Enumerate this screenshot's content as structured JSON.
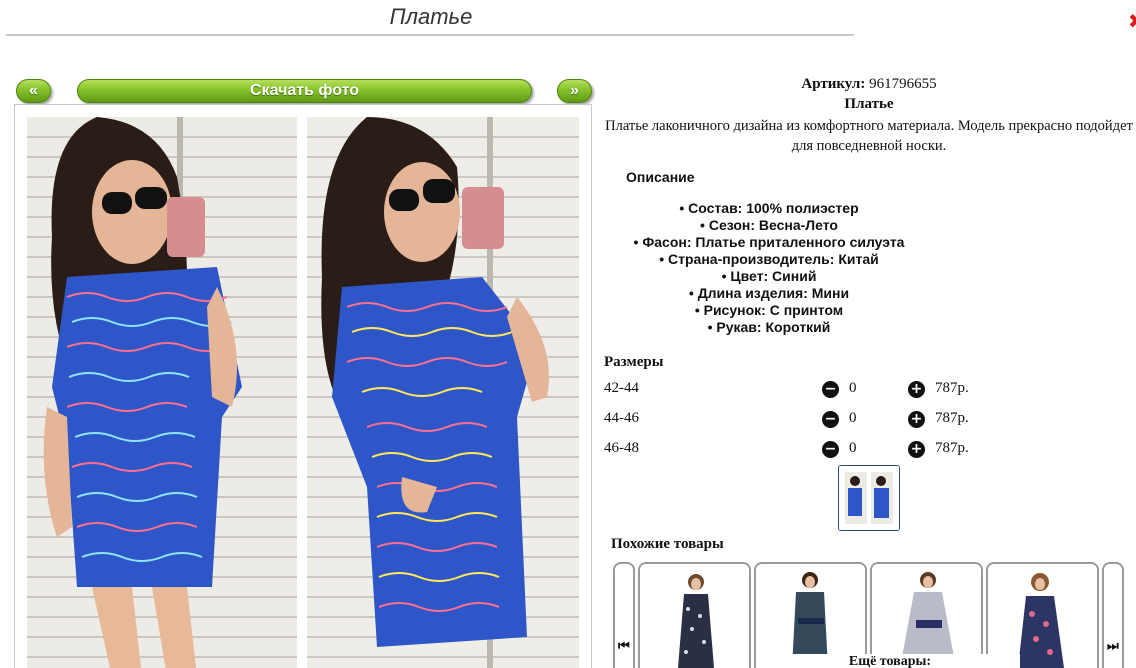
{
  "page": {
    "title": "Платье"
  },
  "gallery": {
    "prev_label": "«",
    "download_label": "Скачать фото",
    "next_label": "»"
  },
  "product": {
    "sku_label": "Артикул:",
    "sku_value": "961796655",
    "name": "Платье",
    "description": "Платье лаконичного дизайна из комфортного материала. Модель прекрасно подойдет для повседневной носки.",
    "description_heading": "Описание",
    "specs": [
      "Состав: 100% полиэстер",
      "Сезон: Весна-Лето",
      "Фасон: Платье приталенного силуэта",
      "Страна-производитель: Китай",
      "Цвет: Синий",
      "Длина изделия: Мини",
      "Рисунок: С принтом",
      "Рукав: Короткий"
    ]
  },
  "sizes": {
    "heading": "Размеры",
    "rows": [
      {
        "size": "42-44",
        "qty": "0",
        "price": "787р."
      },
      {
        "size": "44-46",
        "qty": "0",
        "price": "787р."
      },
      {
        "size": "46-48",
        "qty": "0",
        "price": "787р."
      }
    ]
  },
  "similar": {
    "heading": "Похожие товары",
    "more_label": "Ещё товары:"
  },
  "colors": {
    "button_green": "#86c12c",
    "dress_blue": "#2f56c8"
  }
}
